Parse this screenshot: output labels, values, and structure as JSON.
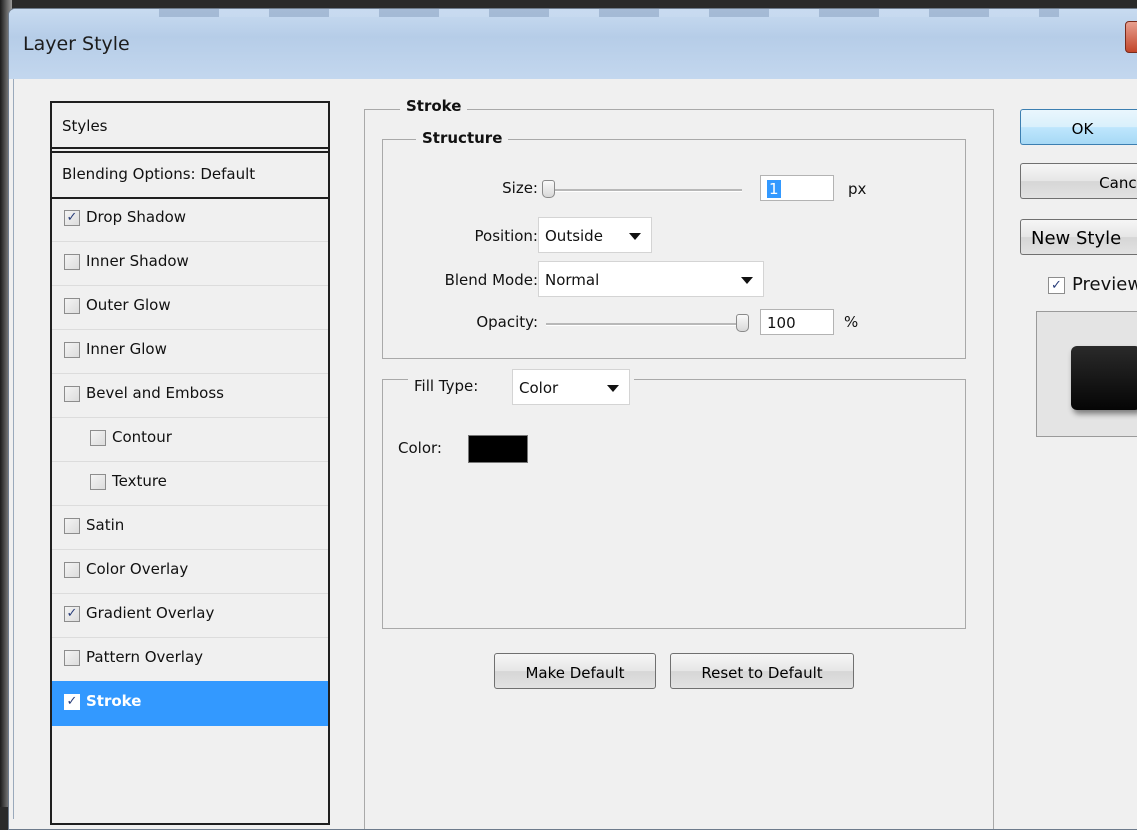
{
  "window": {
    "title": "Layer Style"
  },
  "styles_panel": {
    "header": "Styles",
    "blending_options": "Blending Options: Default",
    "items": [
      {
        "label": "Drop Shadow",
        "checked": true
      },
      {
        "label": "Inner Shadow",
        "checked": false
      },
      {
        "label": "Outer Glow",
        "checked": false
      },
      {
        "label": "Inner Glow",
        "checked": false
      },
      {
        "label": "Bevel and Emboss",
        "checked": false
      },
      {
        "label": "Contour",
        "checked": false
      },
      {
        "label": "Texture",
        "checked": false
      },
      {
        "label": "Satin",
        "checked": false
      },
      {
        "label": "Color Overlay",
        "checked": false
      },
      {
        "label": "Gradient Overlay",
        "checked": true
      },
      {
        "label": "Pattern Overlay",
        "checked": false
      },
      {
        "label": "Stroke",
        "checked": true,
        "selected": true
      }
    ]
  },
  "stroke": {
    "group_title": "Stroke",
    "structure": {
      "title": "Structure",
      "size_label": "Size:",
      "size_value": "1",
      "size_unit": "px",
      "position_label": "Position:",
      "position_value": "Outside",
      "blend_mode_label": "Blend Mode:",
      "blend_mode_value": "Normal",
      "opacity_label": "Opacity:",
      "opacity_value": "100",
      "opacity_unit": "%"
    },
    "fill": {
      "fill_type_label": "Fill Type:",
      "fill_type_value": "Color",
      "color_label": "Color:",
      "color_value": "#000000"
    },
    "make_default_label": "Make Default",
    "reset_default_label": "Reset to Default"
  },
  "actions": {
    "ok_label": "OK",
    "cancel_label": "Cancel",
    "new_style_label": "New Style",
    "preview_label": "Preview",
    "preview_checked": true
  },
  "colors": {
    "selection": "#3399ff",
    "title_bar": "#c3d7ee"
  }
}
